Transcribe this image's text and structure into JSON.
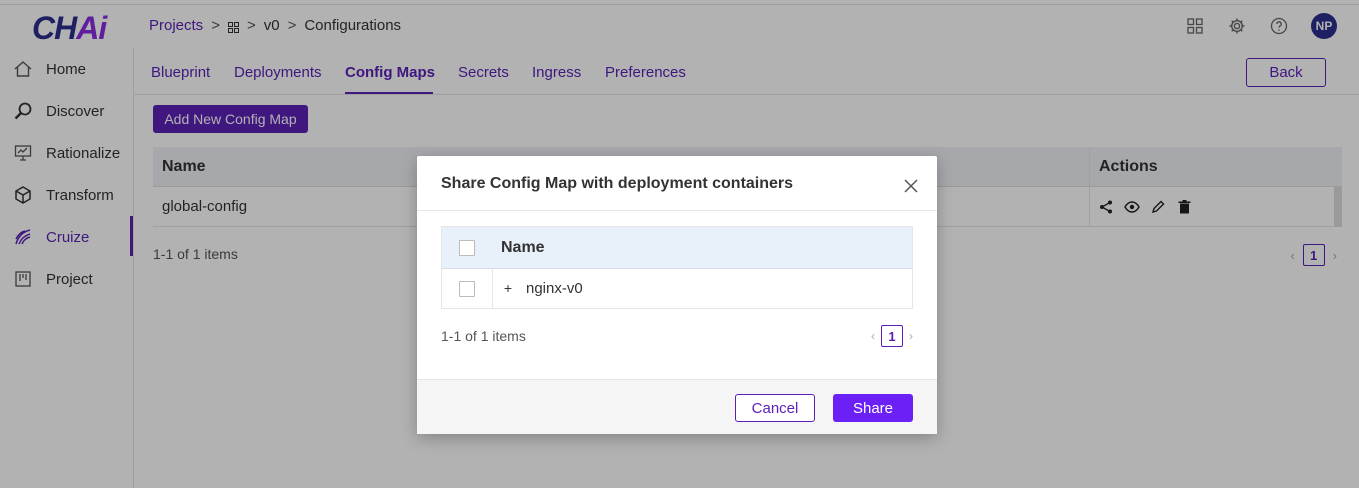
{
  "app": {
    "logo_main": "CH",
    "logo_accent": "Ai"
  },
  "breadcrumb": {
    "projects": "Projects",
    "sep": ">",
    "version": "v0",
    "current": "Configurations"
  },
  "user": {
    "initials": "NP"
  },
  "sidebar": {
    "items": [
      {
        "label": "Home",
        "icon": "home-icon"
      },
      {
        "label": "Discover",
        "icon": "search-icon"
      },
      {
        "label": "Rationalize",
        "icon": "presentation-icon"
      },
      {
        "label": "Transform",
        "icon": "cube-icon"
      },
      {
        "label": "Cruize",
        "icon": "cruize-icon"
      },
      {
        "label": "Project",
        "icon": "board-icon"
      }
    ]
  },
  "tabs": {
    "blueprint": "Blueprint",
    "deployments": "Deployments",
    "config_maps": "Config Maps",
    "secrets": "Secrets",
    "ingress": "Ingress",
    "preferences": "Preferences"
  },
  "toolbar": {
    "back_label": "Back",
    "add_label": "Add New Config Map"
  },
  "grid": {
    "headers": {
      "name": "Name",
      "actions": "Actions"
    },
    "rows": [
      {
        "name": "global-config"
      }
    ],
    "count": "1-1 of 1 items",
    "page": "1"
  },
  "modal": {
    "title": "Share Config Map with deployment containers",
    "header_name": "Name",
    "rows": [
      {
        "name": "nginx-v0"
      }
    ],
    "count": "1-1 of 1 items",
    "page": "1",
    "cancel_label": "Cancel",
    "share_label": "Share"
  },
  "colors": {
    "accent": "#5b21b6",
    "primary_button": "#6b21f5",
    "brand_dark": "#2b2f8f"
  }
}
